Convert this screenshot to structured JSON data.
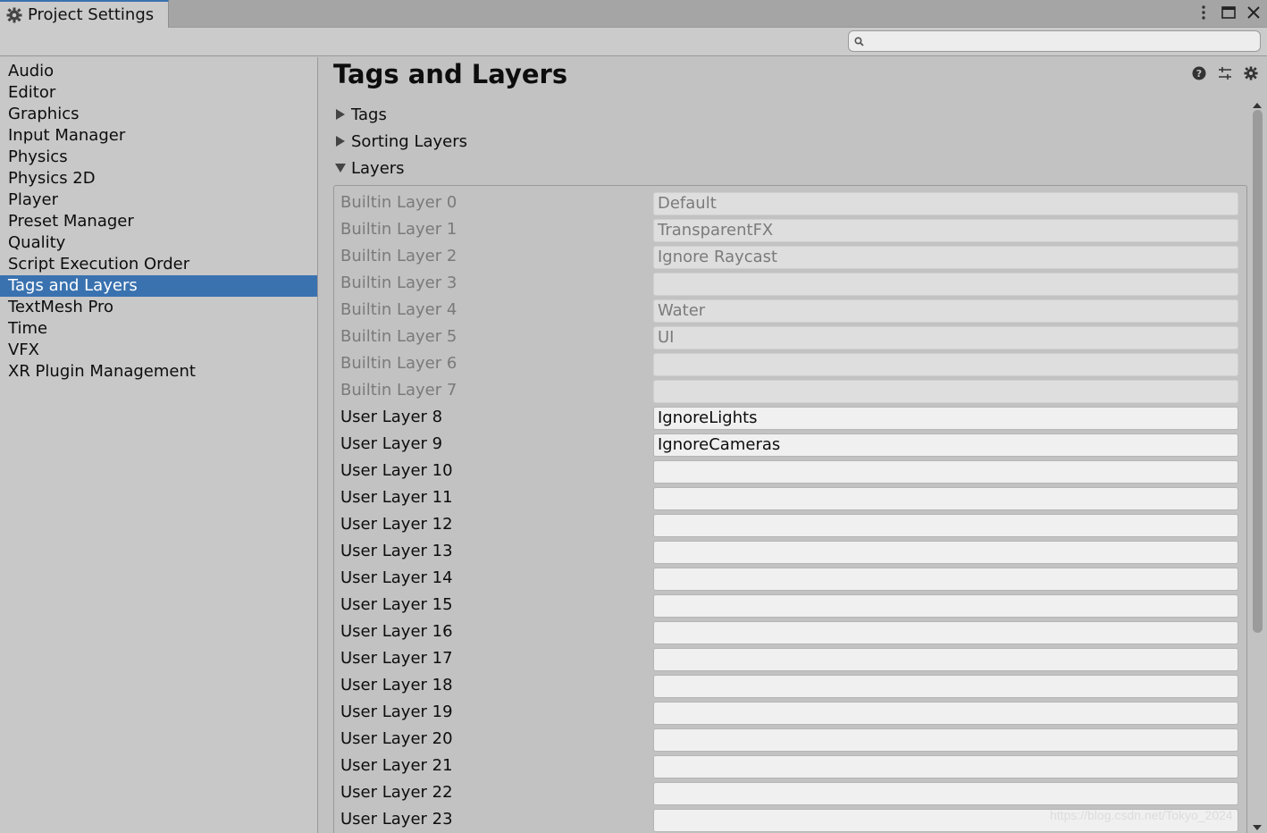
{
  "window": {
    "tab_title": "Project Settings",
    "controls": [
      "more-icon",
      "maximize-icon",
      "close-icon"
    ]
  },
  "search": {
    "value": "",
    "placeholder": ""
  },
  "sidebar": {
    "items": [
      {
        "label": "Audio"
      },
      {
        "label": "Editor"
      },
      {
        "label": "Graphics"
      },
      {
        "label": "Input Manager"
      },
      {
        "label": "Physics"
      },
      {
        "label": "Physics 2D"
      },
      {
        "label": "Player"
      },
      {
        "label": "Preset Manager"
      },
      {
        "label": "Quality"
      },
      {
        "label": "Script Execution Order"
      },
      {
        "label": "Tags and Layers",
        "selected": true
      },
      {
        "label": "TextMesh Pro"
      },
      {
        "label": "Time"
      },
      {
        "label": "VFX"
      },
      {
        "label": "XR Plugin Management"
      }
    ]
  },
  "main": {
    "title": "Tags and Layers",
    "foldouts": [
      {
        "label": "Tags",
        "expanded": false
      },
      {
        "label": "Sorting Layers",
        "expanded": false
      },
      {
        "label": "Layers",
        "expanded": true
      }
    ],
    "layers": [
      {
        "label": "Builtin Layer 0",
        "value": "Default",
        "builtin": true
      },
      {
        "label": "Builtin Layer 1",
        "value": "TransparentFX",
        "builtin": true
      },
      {
        "label": "Builtin Layer 2",
        "value": "Ignore Raycast",
        "builtin": true
      },
      {
        "label": "Builtin Layer 3",
        "value": "",
        "builtin": true
      },
      {
        "label": "Builtin Layer 4",
        "value": "Water",
        "builtin": true
      },
      {
        "label": "Builtin Layer 5",
        "value": "UI",
        "builtin": true
      },
      {
        "label": "Builtin Layer 6",
        "value": "",
        "builtin": true
      },
      {
        "label": "Builtin Layer 7",
        "value": "",
        "builtin": true
      },
      {
        "label": "User Layer 8",
        "value": "IgnoreLights",
        "builtin": false
      },
      {
        "label": "User Layer 9",
        "value": "IgnoreCameras",
        "builtin": false
      },
      {
        "label": "User Layer 10",
        "value": "",
        "builtin": false
      },
      {
        "label": "User Layer 11",
        "value": "",
        "builtin": false
      },
      {
        "label": "User Layer 12",
        "value": "",
        "builtin": false
      },
      {
        "label": "User Layer 13",
        "value": "",
        "builtin": false
      },
      {
        "label": "User Layer 14",
        "value": "",
        "builtin": false
      },
      {
        "label": "User Layer 15",
        "value": "",
        "builtin": false
      },
      {
        "label": "User Layer 16",
        "value": "",
        "builtin": false
      },
      {
        "label": "User Layer 17",
        "value": "",
        "builtin": false
      },
      {
        "label": "User Layer 18",
        "value": "",
        "builtin": false
      },
      {
        "label": "User Layer 19",
        "value": "",
        "builtin": false
      },
      {
        "label": "User Layer 20",
        "value": "",
        "builtin": false
      },
      {
        "label": "User Layer 21",
        "value": "",
        "builtin": false
      },
      {
        "label": "User Layer 22",
        "value": "",
        "builtin": false
      },
      {
        "label": "User Layer 23",
        "value": "",
        "builtin": false
      }
    ]
  },
  "watermark": "https://blog.csdn.net/Tokyo_2024",
  "colors": {
    "selection": "#3a72b0",
    "panel_bg": "#c2c2c2",
    "builtin_text": "#7a7a7a"
  }
}
